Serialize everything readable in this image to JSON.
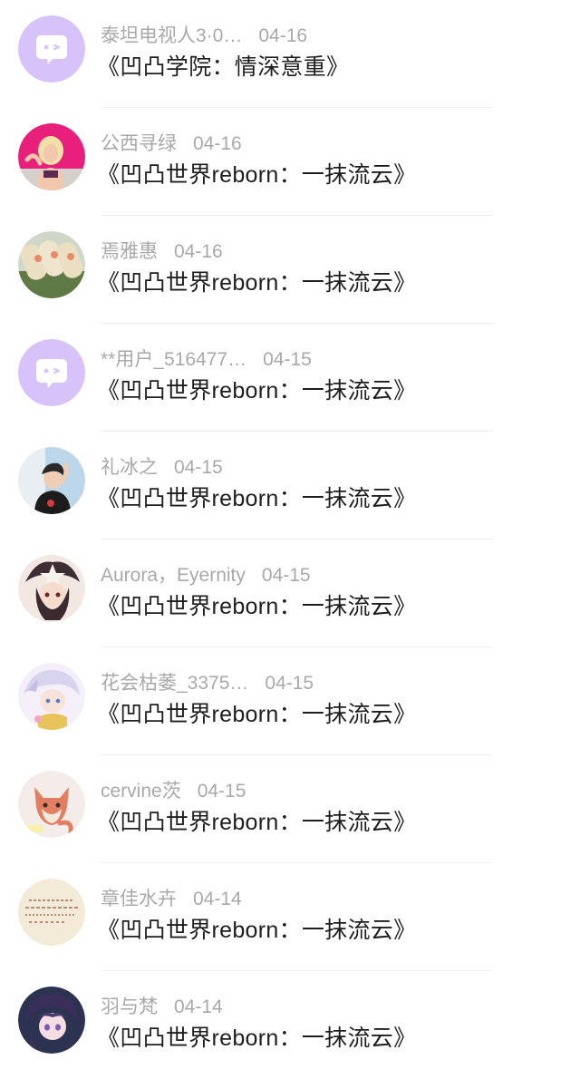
{
  "comments": [
    {
      "username": "泰坦电视人3·0…",
      "date": "04-16",
      "title": "《凹凸学院：情深意重》",
      "avatar": "default-chat-avatar-icon"
    },
    {
      "username": "公西寻绿",
      "date": "04-16",
      "title": "《凹凸世界reborn：一抹流云》",
      "avatar": "user-photo-avatar"
    },
    {
      "username": "焉雅惠",
      "date": "04-16",
      "title": "《凹凸世界reborn：一抹流云》",
      "avatar": "food-photo-avatar"
    },
    {
      "username": "**用户_516477…",
      "date": "04-15",
      "title": "《凹凸世界reborn：一抹流云》",
      "avatar": "default-chat-avatar-icon"
    },
    {
      "username": "礼冰之",
      "date": "04-15",
      "title": "《凹凸世界reborn：一抹流云》",
      "avatar": "user-photo-avatar"
    },
    {
      "username": "Aurora，Eyernity",
      "date": "04-15",
      "title": "《凹凸世界reborn：一抹流云》",
      "avatar": "anime-character-avatar"
    },
    {
      "username": "花会枯萎_3375…",
      "date": "04-15",
      "title": "《凹凸世界reborn：一抹流云》",
      "avatar": "anime-character-avatar"
    },
    {
      "username": "cervine茨",
      "date": "04-15",
      "title": "《凹凸世界reborn：一抹流云》",
      "avatar": "cartoon-fox-avatar"
    },
    {
      "username": "章佳水卉",
      "date": "04-14",
      "title": "《凹凸世界reborn：一抹流云》",
      "avatar": "handwritten-note-avatar"
    },
    {
      "username": "羽与梵",
      "date": "04-14",
      "title": "《凹凸世界reborn：一抹流云》",
      "avatar": "anime-character-avatar"
    }
  ],
  "colors": {
    "meta_text": "#a9a9a9",
    "title_text": "#1e1e1e",
    "default_avatar_bg": "#d7c2fa",
    "divider": "#f1f1f1"
  }
}
